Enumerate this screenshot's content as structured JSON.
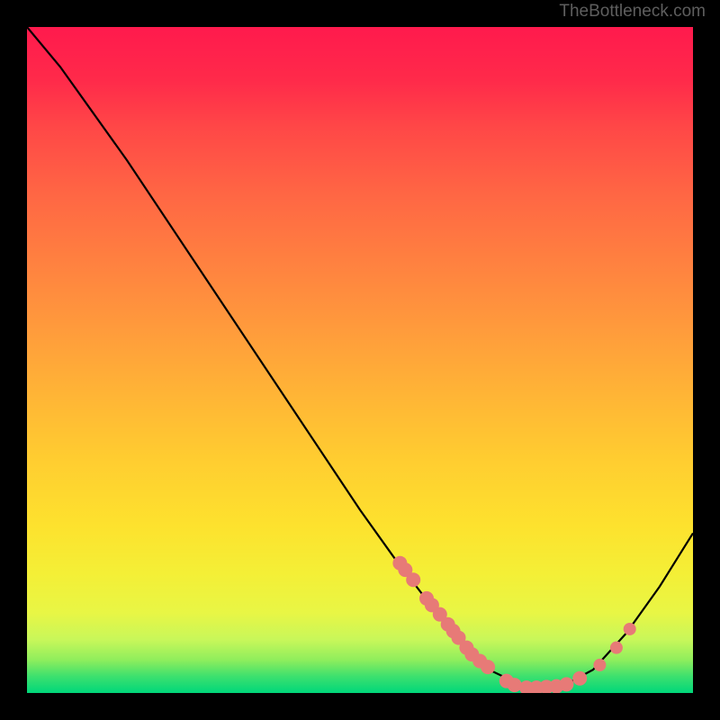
{
  "watermark": "TheBottleneck.com",
  "chart_data": {
    "type": "line",
    "title": "",
    "xlabel": "",
    "ylabel": "",
    "xlim": [
      0,
      100
    ],
    "ylim": [
      0,
      100
    ],
    "grid": false,
    "curve": [
      {
        "x": 0,
        "y": 100
      },
      {
        "x": 5,
        "y": 94
      },
      {
        "x": 10,
        "y": 87
      },
      {
        "x": 15,
        "y": 80
      },
      {
        "x": 20,
        "y": 72.5
      },
      {
        "x": 25,
        "y": 65
      },
      {
        "x": 30,
        "y": 57.5
      },
      {
        "x": 35,
        "y": 50
      },
      {
        "x": 40,
        "y": 42.5
      },
      {
        "x": 45,
        "y": 35
      },
      {
        "x": 50,
        "y": 27.5
      },
      {
        "x": 55,
        "y": 20.5
      },
      {
        "x": 60,
        "y": 14
      },
      {
        "x": 65,
        "y": 8
      },
      {
        "x": 70,
        "y": 3.2
      },
      {
        "x": 75,
        "y": 0.8
      },
      {
        "x": 80,
        "y": 0.8
      },
      {
        "x": 85,
        "y": 3.5
      },
      {
        "x": 90,
        "y": 9
      },
      {
        "x": 95,
        "y": 16
      },
      {
        "x": 100,
        "y": 24
      }
    ],
    "dots_descending": [
      {
        "x": 56,
        "y": 19.5
      },
      {
        "x": 56.8,
        "y": 18.5
      },
      {
        "x": 58,
        "y": 17
      },
      {
        "x": 60,
        "y": 14.2
      },
      {
        "x": 60.8,
        "y": 13.2
      },
      {
        "x": 62,
        "y": 11.8
      },
      {
        "x": 63.2,
        "y": 10.3
      },
      {
        "x": 64,
        "y": 9.3
      },
      {
        "x": 64.8,
        "y": 8.3
      },
      {
        "x": 66,
        "y": 6.8
      },
      {
        "x": 66.8,
        "y": 5.8
      },
      {
        "x": 68,
        "y": 4.8
      },
      {
        "x": 69.2,
        "y": 3.9
      }
    ],
    "dots_trough": [
      {
        "x": 72,
        "y": 1.8
      },
      {
        "x": 73.2,
        "y": 1.2
      },
      {
        "x": 75,
        "y": 0.8
      },
      {
        "x": 76.5,
        "y": 0.8
      },
      {
        "x": 78,
        "y": 0.9
      },
      {
        "x": 79.5,
        "y": 1.0
      },
      {
        "x": 81,
        "y": 1.3
      },
      {
        "x": 83,
        "y": 2.2
      }
    ],
    "dots_ascending": [
      {
        "x": 86,
        "y": 4.2
      },
      {
        "x": 88.5,
        "y": 6.8
      },
      {
        "x": 90.5,
        "y": 9.6
      }
    ],
    "dot_color": "#e77a77",
    "line_color": "#000000"
  }
}
